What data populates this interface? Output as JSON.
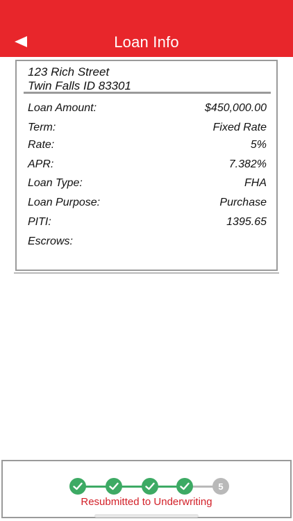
{
  "header": {
    "title": "Loan Info",
    "back_icon": "back-arrow-icon",
    "color": "#e8262b"
  },
  "address": {
    "line1": "123 Rich Street",
    "line2": "Twin Falls ID 83301"
  },
  "loan": {
    "rows": [
      {
        "label": "Loan Amount:",
        "value": "$450,000.00"
      },
      {
        "label": "Term:",
        "value": "Fixed Rate"
      },
      {
        "label": "Rate:",
        "value": "5%"
      },
      {
        "label": "APR:",
        "value": "7.382%"
      },
      {
        "label": "Loan Type:",
        "value": "FHA"
      },
      {
        "label": "Loan Purpose:",
        "value": "Purchase"
      },
      {
        "label": "PITI:",
        "value": "1395.65"
      },
      {
        "label": "Escrows:",
        "value": ""
      }
    ]
  },
  "progress": {
    "steps": [
      {
        "state": "done",
        "icon": "checkmark-icon"
      },
      {
        "state": "done",
        "icon": "checkmark-icon"
      },
      {
        "state": "done",
        "icon": "checkmark-icon"
      },
      {
        "state": "done",
        "icon": "checkmark-icon"
      },
      {
        "state": "todo",
        "label": "5"
      }
    ],
    "status_text": "Resubmitted to Underwriting",
    "done_color": "#3daa64",
    "todo_color": "#b9b9b9",
    "status_color": "#d21f27"
  }
}
